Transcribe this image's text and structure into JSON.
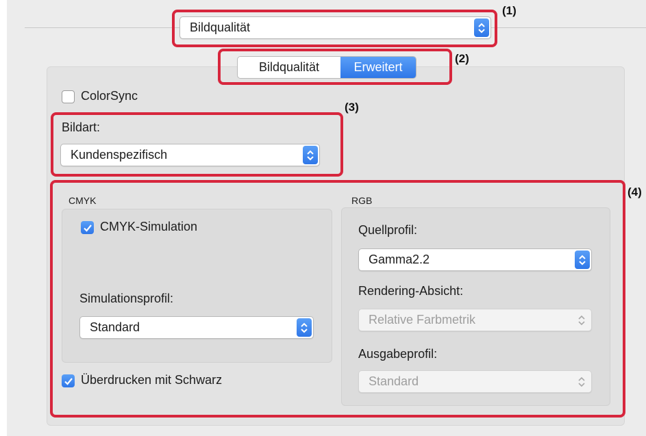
{
  "top_popup": {
    "value": "Bildqualität"
  },
  "tabs": [
    {
      "label": "Bildqualität",
      "selected": false
    },
    {
      "label": "Erweitert",
      "selected": true
    }
  ],
  "colorsync": {
    "label": "ColorSync",
    "checked": false
  },
  "bildart": {
    "label": "Bildart:",
    "value": "Kundenspezifisch"
  },
  "cmyk": {
    "title": "CMYK",
    "simulation": {
      "label": "CMYK-Simulation",
      "checked": true
    },
    "profile_label": "Simulationsprofil:",
    "profile_value": "Standard"
  },
  "overprint": {
    "label": "Überdrucken mit Schwarz",
    "checked": true
  },
  "rgb": {
    "title": "RGB",
    "source_label": "Quellprofil:",
    "source_value": "Gamma2.2",
    "intent_label": "Rendering-Absicht:",
    "intent_value": "Relative Farbmetrik",
    "output_label": "Ausgabeprofil:",
    "output_value": "Standard"
  },
  "callouts": [
    "(1)",
    "(2)",
    "(3)",
    "(4)"
  ],
  "colors": {
    "accent": "#3a83f1",
    "annotation": "#d7263d"
  }
}
